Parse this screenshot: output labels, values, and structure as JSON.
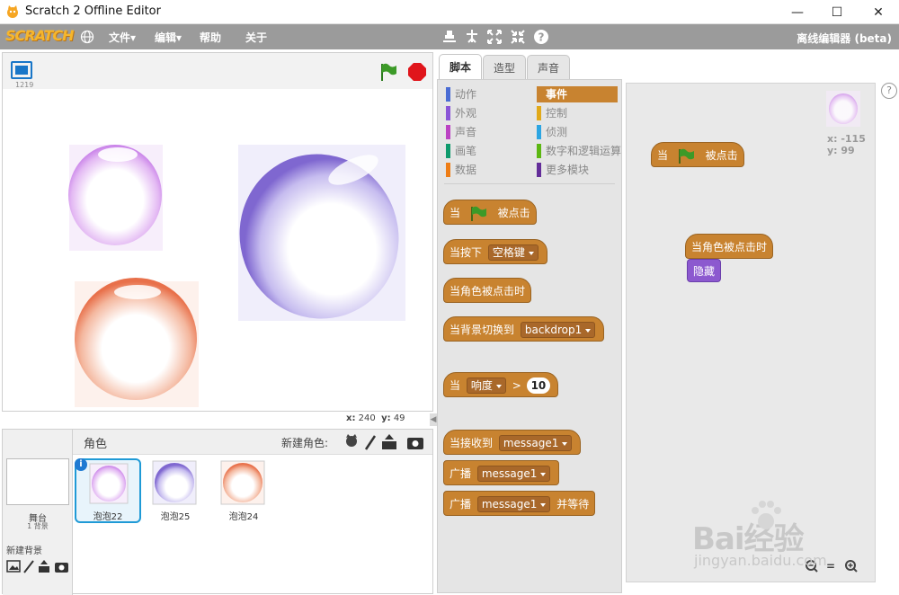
{
  "window": {
    "title": "Scratch 2 Offline Editor",
    "min": "—",
    "max": "☐",
    "close": "✕"
  },
  "menu": {
    "logo": "SCRATCH",
    "file": "文件▾",
    "edit": "编辑▾",
    "help": "帮助",
    "about": "关于",
    "offline": "离线编辑器 (beta)"
  },
  "stage": {
    "version": "1219",
    "x_label": "x:",
    "x_value": "240",
    "y_label": "y:",
    "y_value": "49"
  },
  "sprites": {
    "header": "角色",
    "new_sprite": "新建角色:",
    "stage_label": "舞台",
    "stage_count": "1 背景",
    "new_backdrop": "新建背景",
    "items": [
      {
        "name": "泡泡22",
        "color": "#c77ee8"
      },
      {
        "name": "泡泡25",
        "color": "#8f79d6"
      },
      {
        "name": "泡泡24",
        "color": "#e8704a"
      }
    ]
  },
  "tabs": {
    "scripts": "脚本",
    "costumes": "造型",
    "sounds": "声音"
  },
  "categories": [
    {
      "label": "动作",
      "color": "#4a6cd4"
    },
    {
      "label": "外观",
      "color": "#8a55d7"
    },
    {
      "label": "声音",
      "color": "#bb42c3"
    },
    {
      "label": "画笔",
      "color": "#0e9a6c"
    },
    {
      "label": "数据",
      "color": "#ee7d16"
    },
    {
      "label": "事件",
      "color": "#c88330"
    },
    {
      "label": "控制",
      "color": "#e1a91a"
    },
    {
      "label": "侦测",
      "color": "#2ca5e2"
    },
    {
      "label": "数字和逻辑运算",
      "color": "#5cb712"
    },
    {
      "label": "更多模块",
      "color": "#632d99"
    }
  ],
  "palette": {
    "when": "当",
    "clicked": "被点击",
    "key_pressed": "当按下",
    "key": "空格键",
    "sprite_clicked": "当角色被点击时",
    "backdrop_switch": "当背景切换到",
    "backdrop": "backdrop1",
    "loudness": "响度",
    "gt": ">",
    "ten": "10",
    "receive": "当接收到",
    "message": "message1",
    "broadcast": "广播",
    "and_wait": "并等待"
  },
  "scripts": {
    "when": "当",
    "clicked": "被点击",
    "sprite_clicked": "当角色被点击时",
    "hide": "隐藏",
    "x": "x: -115",
    "y": "y: 99"
  },
  "watermark": {
    "brand": "Bai经验",
    "url": "jingyan.baidu.com"
  },
  "colors": {
    "menubar": "#9b9b9b",
    "event": "#c88330",
    "looks": "#8c59cf",
    "select": "#1f9ad6"
  }
}
